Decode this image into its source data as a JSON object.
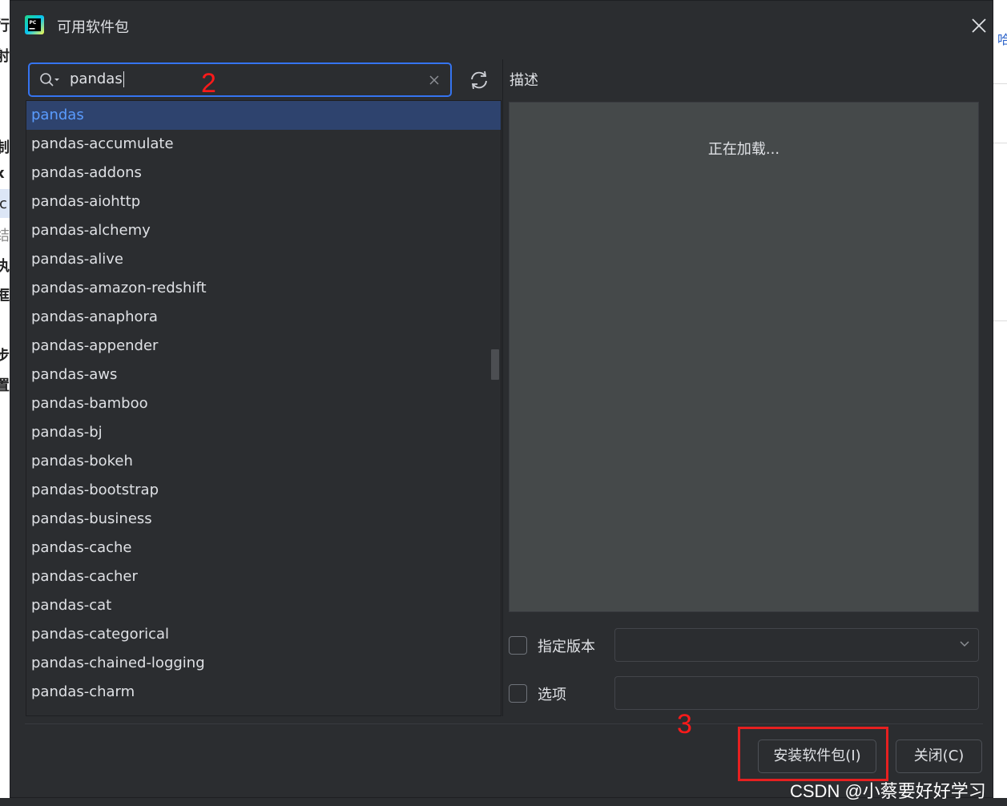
{
  "window": {
    "title": "可用软件包",
    "colors": {
      "background": "#2b2d30",
      "accent": "#3574f0",
      "selection": "#2e436e",
      "annotation": "#ff1a1a"
    }
  },
  "background_ui": {
    "left_chars": [
      "行",
      "射",
      "制",
      "x",
      "ic",
      "结",
      "执",
      "框",
      "步",
      "置"
    ],
    "right_char": "哈"
  },
  "search": {
    "value": "pandas",
    "icons": [
      "search-icon",
      "clear-icon",
      "refresh-icon"
    ]
  },
  "packages": {
    "selected_index": 0,
    "items": [
      "pandas",
      "pandas-accumulate",
      "pandas-addons",
      "pandas-aiohttp",
      "pandas-alchemy",
      "pandas-alive",
      "pandas-amazon-redshift",
      "pandas-anaphora",
      "pandas-appender",
      "pandas-aws",
      "pandas-bamboo",
      "pandas-bj",
      "pandas-bokeh",
      "pandas-bootstrap",
      "pandas-business",
      "pandas-cache",
      "pandas-cacher",
      "pandas-cat",
      "pandas-categorical",
      "pandas-chained-logging",
      "pandas-charm"
    ]
  },
  "description": {
    "label": "描述",
    "loading_text": "正在加载..."
  },
  "options": {
    "version_label": "指定版本",
    "version_value": "",
    "version_checked": false,
    "options_label": "选项",
    "options_value": "",
    "options_checked": false
  },
  "buttons": {
    "install": "安装软件包(I)",
    "close": "关闭(C)"
  },
  "annotations": {
    "step2": "2",
    "step3": "3"
  },
  "watermark": "CSDN @小蔡要好好学习"
}
